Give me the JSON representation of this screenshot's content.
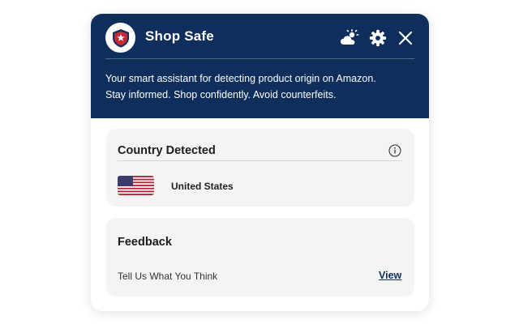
{
  "app": {
    "title": "Shop Safe",
    "tagline_line1": "Your smart assistant for detecting product origin on Amazon.",
    "tagline_line2": "Stay informed. Shop confidently. Avoid counterfeits."
  },
  "header": {
    "icons": [
      "weather-theme-icon",
      "gear-icon",
      "close-icon"
    ]
  },
  "country_card": {
    "title": "Country Detected",
    "country": "United States",
    "flag_icon": "us-flag-icon",
    "info_icon": "info-icon"
  },
  "feedback_card": {
    "title": "Feedback",
    "text": "Tell Us What You Think",
    "link_label": "View"
  },
  "colors": {
    "header_bg": "#0e2e5c",
    "card_bg": "#f4f4f4",
    "logo_red": "#c62a3a"
  }
}
